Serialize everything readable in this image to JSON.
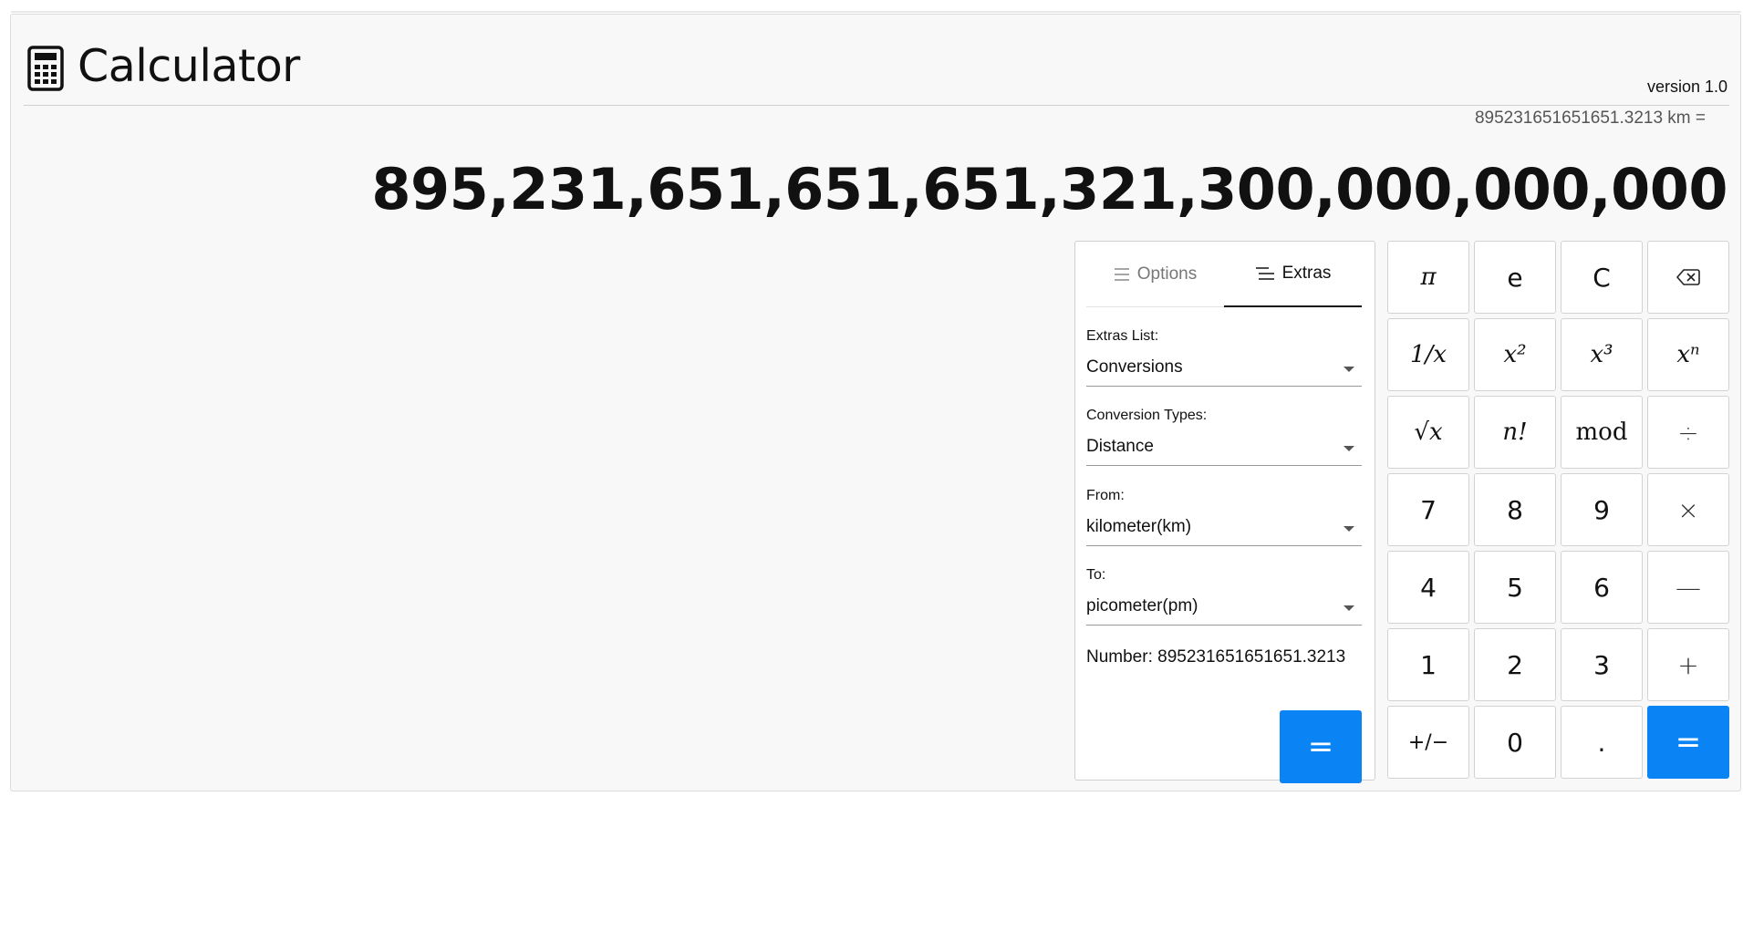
{
  "header": {
    "title": "Calculator",
    "version": "version 1.0"
  },
  "display": {
    "expression": "895231651651651.3213 km =",
    "result": "895,231,651,651,651,321,300,000,000,000"
  },
  "panel": {
    "tabs": [
      {
        "label": "Options",
        "active": false
      },
      {
        "label": "Extras",
        "active": true
      }
    ],
    "fields": [
      {
        "label": "Extras List:",
        "value": "Conversions"
      },
      {
        "label": "Conversion Types:",
        "value": "Distance"
      },
      {
        "label": "From:",
        "value": "kilometer(km)"
      },
      {
        "label": "To:",
        "value": "picometer(pm)"
      }
    ],
    "number_text": "Number: 895231651651651.3213",
    "equals_label": "="
  },
  "keypad": {
    "pi": "π",
    "e": "e",
    "clear": "C",
    "backspace_icon": "backspace-icon",
    "reciprocal": "1/x",
    "square": "x²",
    "cube": "x³",
    "power": "xⁿ",
    "sqrt": "√x",
    "factorial": "n!",
    "mod": "mod",
    "divide": "÷",
    "seven": "7",
    "eight": "8",
    "nine": "9",
    "multiply": "×",
    "four": "4",
    "five": "5",
    "six": "6",
    "minus": "—",
    "one": "1",
    "two": "2",
    "three": "3",
    "plus": "+",
    "plusminus": "+/−",
    "zero": "0",
    "decimal": ".",
    "equals": "="
  },
  "colors": {
    "accent": "#0a84f5",
    "background": "#f8f8f8"
  }
}
